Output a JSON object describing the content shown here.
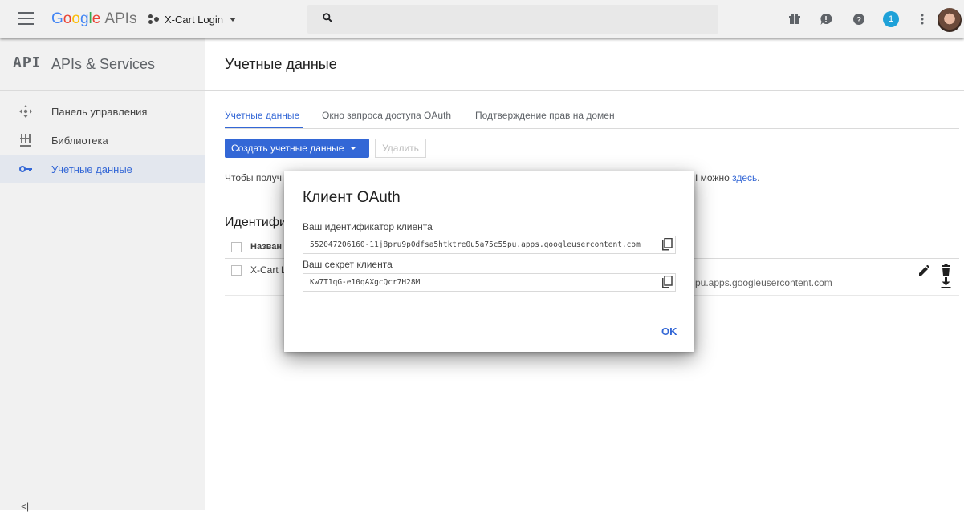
{
  "topbar": {
    "brand_google": [
      "G",
      "o",
      "o",
      "g",
      "l",
      "e"
    ],
    "brand_apis": "APIs",
    "project_name": "X-Cart Login",
    "notification_count": "1"
  },
  "sidebar": {
    "logo": "API",
    "title": "APIs & Services",
    "items": [
      {
        "label": "Панель управления",
        "icon": "dashboard-icon"
      },
      {
        "label": "Библиотека",
        "icon": "library-icon"
      },
      {
        "label": "Учетные данные",
        "icon": "key-icon",
        "active": true
      }
    ],
    "collapse": "<|"
  },
  "main": {
    "title": "Учетные данные",
    "tabs": [
      {
        "label": "Учетные данные",
        "active": true
      },
      {
        "label": "Окно запроса доступа OAuth"
      },
      {
        "label": "Подтверждение прав на домен"
      }
    ],
    "create_button": "Создать учетные данные",
    "delete_button": "Удалить",
    "intro_left": "Чтобы получ",
    "intro_right": "I можно ",
    "intro_link": "здесь",
    "intro_end": ".",
    "section_title": "Идентифик",
    "table": {
      "col_name": "Назван",
      "rows": [
        {
          "name": "X-Cart L",
          "client_id_tail": "pu.apps.googleusercontent.com"
        }
      ]
    }
  },
  "dialog": {
    "title": "Клиент OAuth",
    "client_id_label": "Ваш идентификатор клиента",
    "client_id": "552047206160-11j8pru9p0dfsa5htktre0u5a75c55pu.apps.googleusercontent.com",
    "client_secret_label": "Ваш секрет клиента",
    "client_secret": "Kw7T1qG-e10qAXgcQcr7H28M",
    "ok_button": "OK"
  },
  "colors": {
    "accent": "#3367d6",
    "topbar_bg": "#f1f1f1",
    "sidebar_bg": "#f1f1f1",
    "badge": "#1ea1d8"
  }
}
